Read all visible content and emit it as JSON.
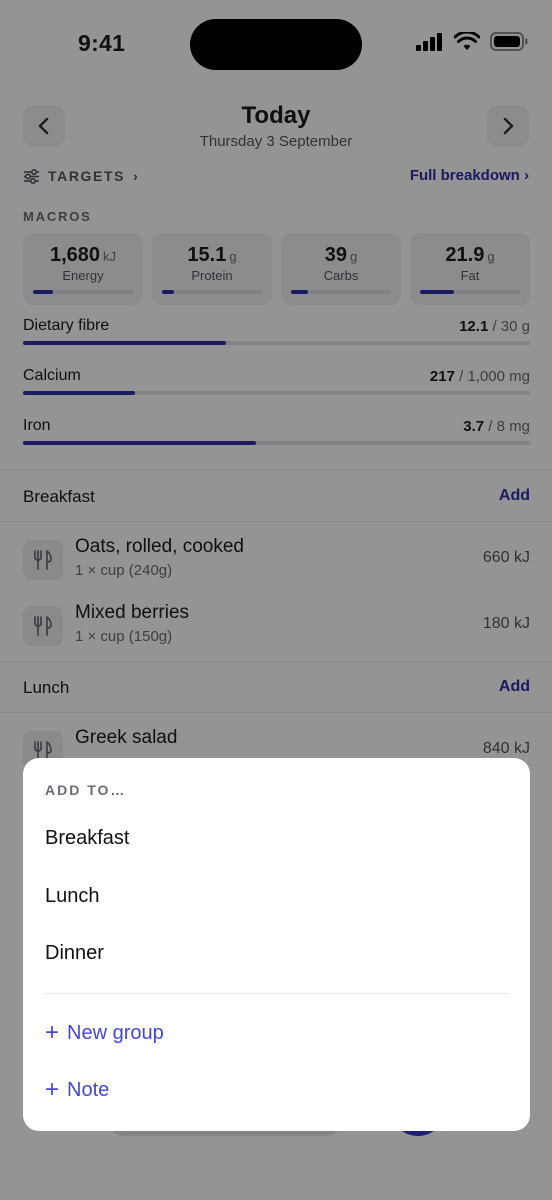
{
  "status_bar": {
    "time": "9:41"
  },
  "header": {
    "title": "Today",
    "subtitle": "Thursday 3 September"
  },
  "targets": {
    "label": "TARGETS",
    "chevron": "›",
    "full_breakdown": "Full breakdown ›"
  },
  "macros": {
    "label": "MACROS",
    "items": [
      {
        "value": "1,680",
        "unit": "kJ",
        "name": "Energy",
        "progress": 0.2
      },
      {
        "value": "15.1",
        "unit": "g",
        "name": "Protein",
        "progress": 0.12
      },
      {
        "value": "39",
        "unit": "g",
        "name": "Carbs",
        "progress": 0.17
      },
      {
        "value": "21.9",
        "unit": "g",
        "name": "Fat",
        "progress": 0.34
      }
    ]
  },
  "nutrients": [
    {
      "name": "Dietary fibre",
      "value": "12.1",
      "target": " / 30 g",
      "progress": 0.4
    },
    {
      "name": "Calcium",
      "value": "217",
      "target": " / 1,000 mg",
      "progress": 0.22
    },
    {
      "name": "Iron",
      "value": "3.7",
      "target": " / 8 mg",
      "progress": 0.46
    }
  ],
  "groups": [
    {
      "name": "Breakfast",
      "add_label": "Add",
      "items": [
        {
          "name": "Oats, rolled, cooked",
          "portion": "1 × cup (240g)",
          "energy": "660 kJ"
        },
        {
          "name": "Mixed berries",
          "portion": "1 × cup (150g)",
          "energy": "180 kJ"
        }
      ]
    },
    {
      "name": "Lunch",
      "add_label": "Add",
      "items": [
        {
          "name": "Greek salad",
          "portion": "",
          "energy": "840 kJ"
        }
      ]
    }
  ],
  "sheet": {
    "title": "ADD TO…",
    "options": [
      "Breakfast",
      "Lunch",
      "Dinner"
    ],
    "actions": [
      "New group",
      "Note"
    ],
    "plus": "+"
  },
  "colors": {
    "accent": "#2e2fa8",
    "sheet_accent": "#4446d6",
    "overlay": "rgba(0,0,0,0.42)"
  },
  "icons": [
    "chevron-left-icon",
    "chevron-right-icon",
    "sliders-icon",
    "fork-knife-icon",
    "signal-icon",
    "wifi-icon",
    "battery-icon"
  ]
}
